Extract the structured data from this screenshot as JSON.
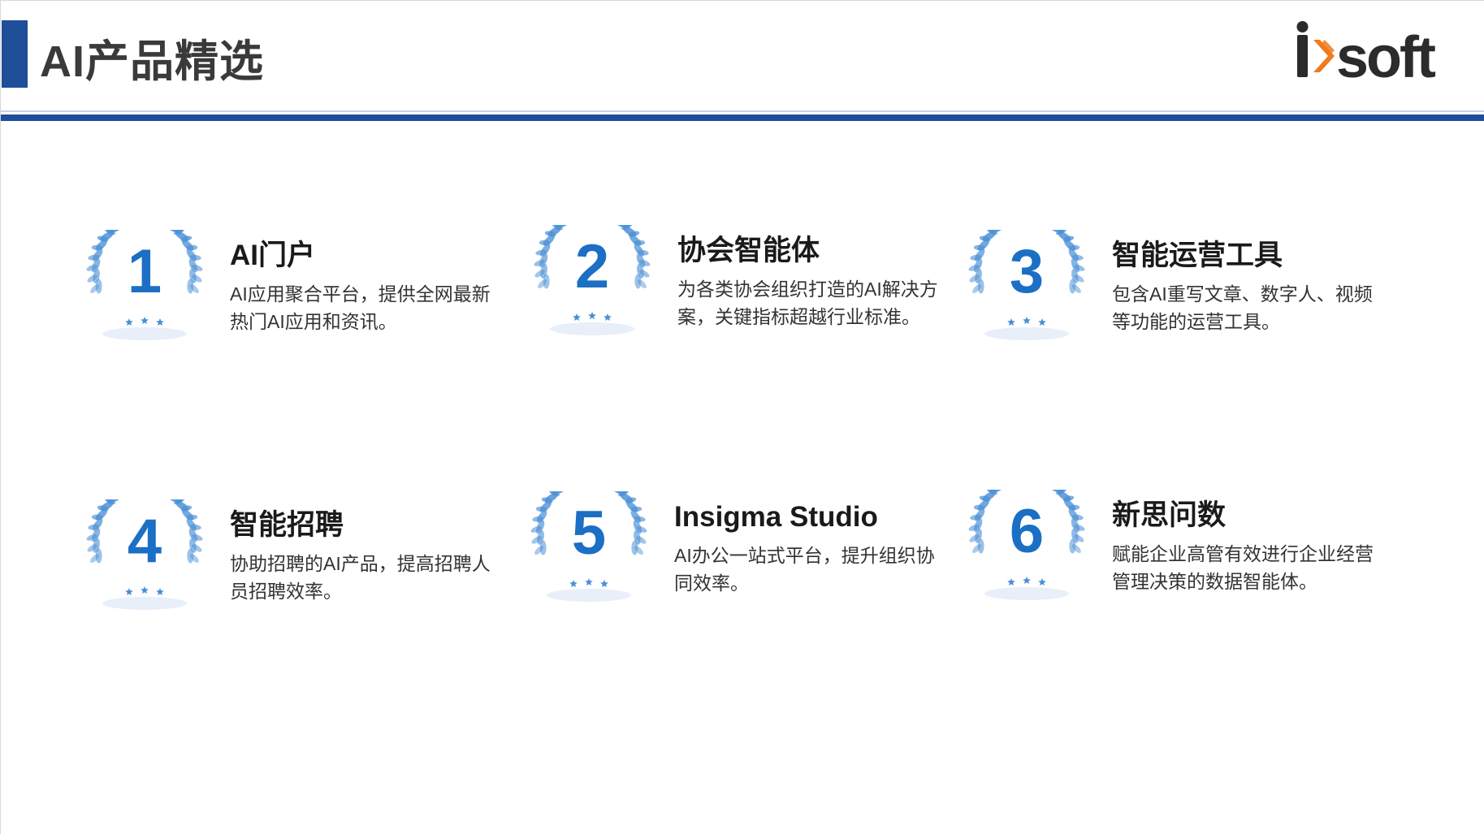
{
  "header": {
    "title": "AI产品精选",
    "logo_text_left": "i",
    "logo_text_right": "soft"
  },
  "colors": {
    "brand_blue": "#1f4e9a",
    "badge_blue": "#1b6fc4",
    "laurel_blue": "#4a8fd6",
    "logo_dark": "#2b2b2b",
    "logo_orange": "#f07a1d"
  },
  "cards": [
    {
      "number": "1",
      "title": "AI门户",
      "desc": "AI应用聚合平台，提供全网最新热门AI应用和资讯。"
    },
    {
      "number": "2",
      "title": "协会智能体",
      "desc": "为各类协会组织打造的AI解决方案，关键指标超越行业标准。"
    },
    {
      "number": "3",
      "title": "智能运营工具",
      "desc": "包含AI重写文章、数字人、视频等功能的运营工具。"
    },
    {
      "number": "4",
      "title": "智能招聘",
      "desc": "协助招聘的AI产品，提高招聘人员招聘效率。"
    },
    {
      "number": "5",
      "title": "Insigma Studio",
      "desc": "AI办公一站式平台，提升组织协同效率。"
    },
    {
      "number": "6",
      "title": "新思问数",
      "desc": "赋能企业高管有效进行企业经营管理决策的数据智能体。"
    }
  ]
}
